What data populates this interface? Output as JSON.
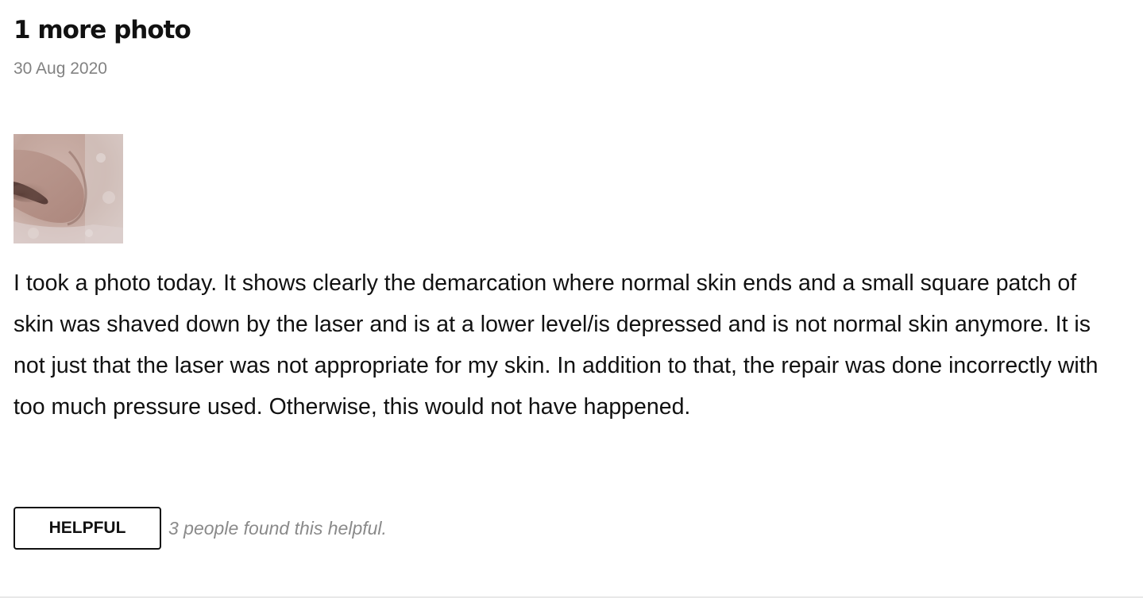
{
  "review": {
    "title": "1 more photo",
    "date": "30 Aug 2020",
    "photo": {
      "alt": "Close-up photo of skin on nose",
      "skin_color": "#c9aea6",
      "shadow_color": "#7e5e56"
    },
    "body": "I took a photo today. It shows clearly the demarcation where normal skin ends and a small square patch of skin was shaved down by the laser and is at a lower level/is depressed and is not normal skin anymore. It is not just that the laser was not appropriate for my skin. In addition to that, the repair was done incorrectly with too much pressure used. Otherwise, this would not have happened.",
    "helpful_button_label": "HELPFUL",
    "helpful_count_text": "3 people found this helpful."
  }
}
